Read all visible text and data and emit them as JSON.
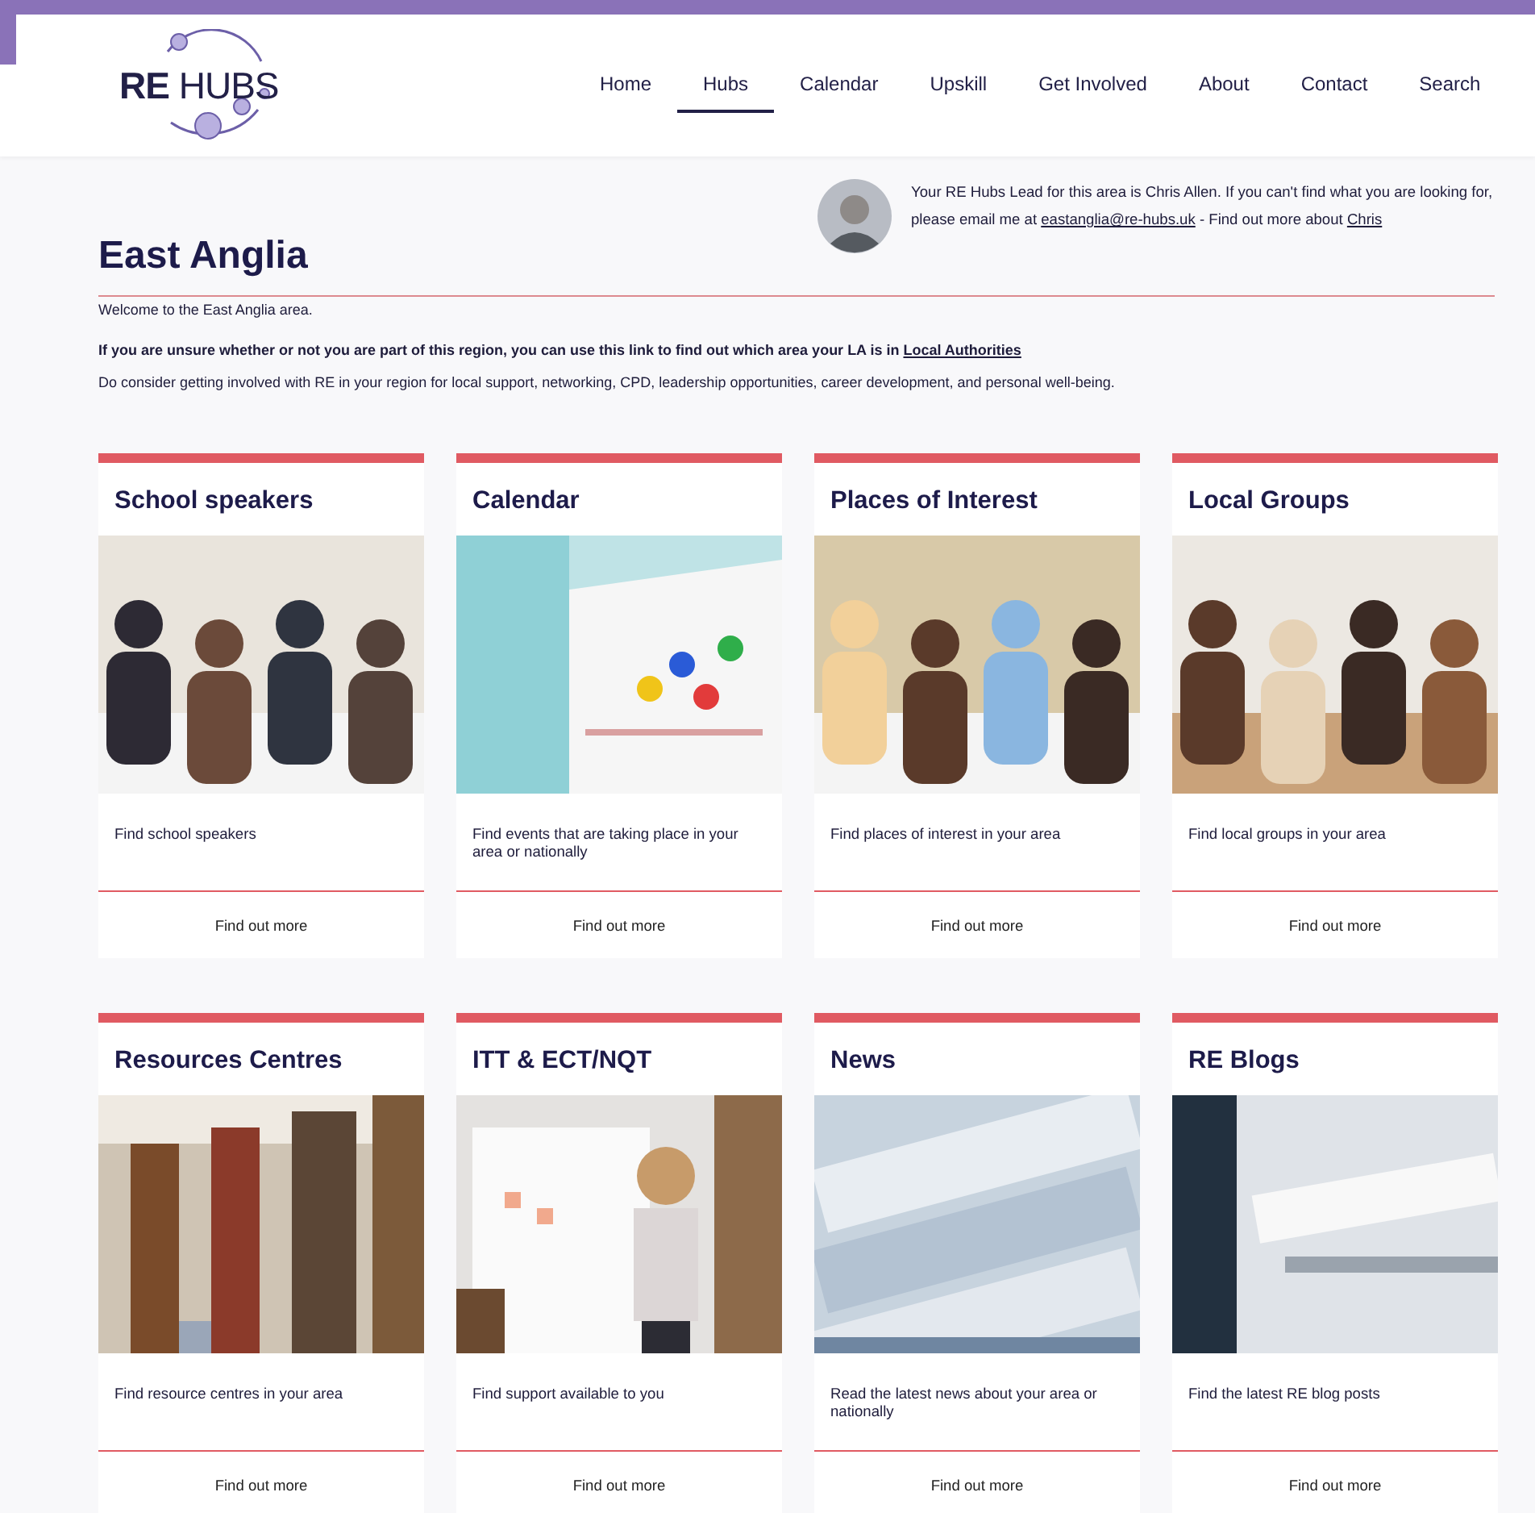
{
  "logo": {
    "strong": "RE",
    "light": "HUBS"
  },
  "nav": [
    {
      "label": "Home",
      "selected": false
    },
    {
      "label": "Hubs",
      "selected": true
    },
    {
      "label": "Calendar",
      "selected": false
    },
    {
      "label": "Upskill",
      "selected": false
    },
    {
      "label": "Get Involved",
      "selected": false
    },
    {
      "label": "About",
      "selected": false
    },
    {
      "label": "Contact",
      "selected": false
    },
    {
      "label": "Search",
      "selected": false
    }
  ],
  "title": "East Anglia",
  "lead": [
    {
      "text": "Your RE Hubs Lead for this area is Chris Allen. If you can't find what you are looking for, please email me at "
    },
    {
      "link": "eastanglia@re-hubs.uk"
    },
    {
      "text": " - Find out more about "
    },
    {
      "link": "Chris"
    }
  ],
  "paragraphs": [
    {
      "text": "Welcome to the East Anglia area.",
      "bold": false
    },
    {
      "text": "If you are unsure whether or not you are part of this region, you can use this link to find out which area your LA is in ",
      "link": "Local Authorities",
      "bold": true
    },
    {
      "text": "Do consider getting involved with RE in your region for local support, networking, CPD, leadership opportunities, career development, and personal well-being.",
      "bold": false
    }
  ],
  "cards": [
    {
      "title": "School speakers",
      "description": "Find school speakers",
      "button": "Find out more"
    },
    {
      "title": "Calendar",
      "description": "Find events that are taking place in your area or nationally",
      "button": "Find out more"
    },
    {
      "title": "Places of Interest",
      "description": "Find places of interest in your area",
      "button": "Find out more"
    },
    {
      "title": "Local Groups",
      "description": "Find local groups in your area",
      "button": "Find out more"
    },
    {
      "title": "Resources Centres",
      "description": "Find resource centres in your area",
      "button": "Find out more"
    },
    {
      "title": "ITT & ECT/NQT",
      "description": "Find support available to you",
      "button": "Find out more"
    },
    {
      "title": "News",
      "description": "Read the latest news about your area or nationally",
      "button": "Find out more"
    },
    {
      "title": "RE Blogs",
      "description": "Find the latest RE blog posts",
      "button": "Find out more"
    }
  ]
}
